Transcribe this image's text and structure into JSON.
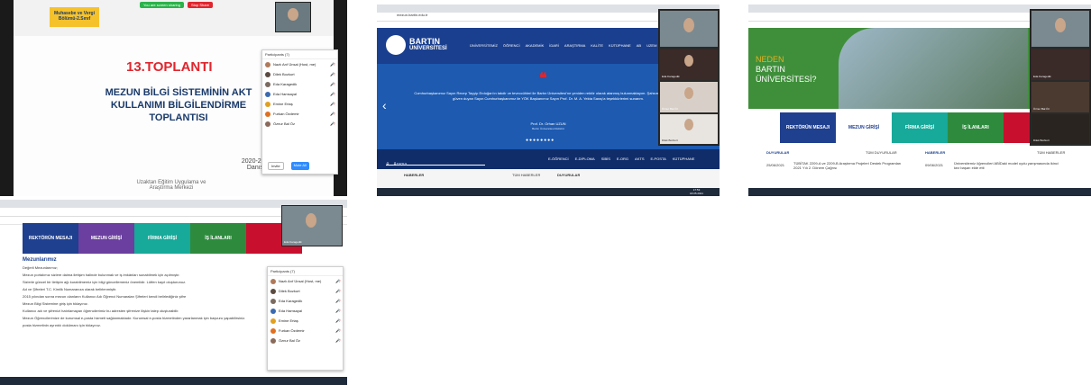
{
  "shot1": {
    "brand_line1": "Muhasebe ve Vergi",
    "brand_line2": "Bölümü-2.Sınıf",
    "share_label": "You are screen sharing",
    "stop_label": "Stop Share",
    "meeting_number": "13.TOPLANTI",
    "title_line1": "MEZUN BİLGİ SİSTEMİNİN AKT",
    "title_line2": "KULLANIMI BİLGİLENDİRME",
    "title_line3": "TOPLANTISI",
    "year_line1": "2020-2021 Bahar",
    "year_line2": "Danışmanlık To",
    "org_line1": "Uzaktan Eğitim Uygulama ve",
    "org_line2": "Araştırma Merkezi",
    "panel_title": "Participants (7)",
    "participants": [
      {
        "name": "Nazlı Arıf Ünsal (Host, me)",
        "color": "#b07a5a"
      },
      {
        "name": "Dilek Bozkurt",
        "color": "#5a4a40"
      },
      {
        "name": "Eda Karagedik",
        "color": "#7a6a60"
      },
      {
        "name": "Eda Hamsayal",
        "color": "#3a6ab0"
      },
      {
        "name": "Emine Ertaş",
        "color": "#e0a020"
      },
      {
        "name": "Furkan Özdemir",
        "color": "#e07020"
      },
      {
        "name": "Öznur Bal Öz",
        "color": "#8a6a5a"
      }
    ],
    "invite_label": "Invite",
    "mute_all_label": "Mute All"
  },
  "shot2": {
    "url": "mezun.bartin.edu.tr",
    "logo_line1": "BARTIN",
    "logo_line2": "ÜNİVERSİTESİ",
    "nav": [
      "ÜNİVERSİTEMİZ",
      "ÖĞRENCİ",
      "AKADEMİK",
      "İDARİ",
      "ARAŞTIRMA",
      "KALİTE",
      "KÜTÜPHANE",
      "AB",
      "UZEM"
    ],
    "quote_text": "Cumhurbaşkanımız Sayın Recep Tayyip Erdoğan'ın takdir ve teveccühleri ile Bartın Üniversitesi'ne yeniden rektör olarak atanmış bulunmaktayım. Şahsım ile görevimize güven duyan Sayın Cumhurbaşkanımız ile YÖK Başkanımız Sayın Prof. Dr. M. A. Yekta Saraç'a teşekkürlerimi sunarım.",
    "quote_author": "Prof. Dr. Orhan UZUN",
    "quote_role": "Bartın Üniversitesi Rektörü",
    "search_placeholder": "Arama",
    "bottom_links": [
      "E-ÖĞRENCİ",
      "E-DİPLOMA",
      "SİBİS",
      "E-ORG",
      "AKTS",
      "E-POSTA",
      "KÜTÜPHANE"
    ],
    "news_title": "HABERLER",
    "all_news": "TÜM HABERLER",
    "announce_title": "DUYURULAR",
    "cam_names": [
      "Eda Karagedik",
      "Öznur Bal Öz",
      "Dilek Bozkurt"
    ],
    "clock_time": "17:53",
    "clock_date": "18.05.2021"
  },
  "shot3": {
    "hero_line1": "NEDEN",
    "hero_line2": "BARTIN",
    "hero_line3": "ÜNİVERSİTESİ?",
    "tiles": [
      {
        "label": "REKTÖRÜN MESAJI",
        "bg": "#1f3f8f",
        "fg": "#ffffff"
      },
      {
        "label": "MEZUN GİRİŞİ",
        "bg": "#ffffff",
        "fg": "#1f3f8f"
      },
      {
        "label": "FİRMA GİRİŞİ",
        "bg": "#17a99a",
        "fg": "#ffffff"
      },
      {
        "label": "İŞ İLANLARI",
        "bg": "#2e8b3e",
        "fg": "#ffffff"
      },
      {
        "label": "",
        "bg": "#c8102e",
        "fg": "#ffffff"
      }
    ],
    "col1_title": "DUYURULAR",
    "col1_all": "TÜM DUYURULAR",
    "col2_title": "HABERLER",
    "col2_all": "TÜM HABERLER",
    "item1_date": "25/06/2021",
    "item1_text": "TÜBİTAK 2209-A ve 2209-B Araştırma Projeleri Destek Programları 2021 Yılı 2. Dönem Çağrısı",
    "item2_date": "09/06/2021",
    "item2_text": "Üniversitemiz öğrencileri ABİDaki model uydu yarışmasında ikinci kez başarı elde etti",
    "cam_names": [
      "Eda Karagedik",
      "Öznur Bal Öz",
      "Dilek Bozkurt"
    ]
  },
  "shot4": {
    "tiles": [
      {
        "label": "REKTÖRÜN MESAJI",
        "bg": "#1f3f8f"
      },
      {
        "label": "MEZUN GİRİŞİ",
        "bg": "#6a3f9f"
      },
      {
        "label": "FİRMA GİRİŞİ",
        "bg": "#17a99a"
      },
      {
        "label": "İŞ İLANLARI",
        "bg": "#2e8b3e"
      },
      {
        "label": "",
        "bg": "#c8102e"
      }
    ],
    "heading": "Mezunlarımız",
    "greeting": "Değerli Mezunlarımız;",
    "paragraphs": [
      "Mezun portalımız sizlere daima iletişim halinde bulunmak ve iş imkânları sunabilmek için açılmıştır.",
      "Sizlerle güncel bir iletişim ağı kurabilmemiz için bilgi güncellemeniz önemlidir. Lütfen kayıt oluşturunuz.",
      "Ad ve Şifreleri T.C. Kimlik Numaranıza olarak belirlenmiştir.",
      "2015 yılından sonra mezun olanların Kullanıcı Adı Öğrenci Numaraları Şifreleri kendi belirlediğiniz şifre",
      "Mezun Bilgi Sistemine giriş için tıklayınız.",
      "Kullanıcı adı ve şifrenizi hatırlamayan öğrencilerimiz bu adresten şifrenize ilişkin talep oluşturabilir.",
      "Mezun Öğrencilerimize de kurumsal e-posta hizmeti sağlanmaktadır. Kurumsal e-posta hizmetinden yararlanmak için başvuru yapabilirsiniz.",
      "posta hizmetinin ayrıntılı dokümanı için tıklayınız."
    ],
    "panel_title": "Participants (7)",
    "cam_name": "Eda Karagedik"
  }
}
